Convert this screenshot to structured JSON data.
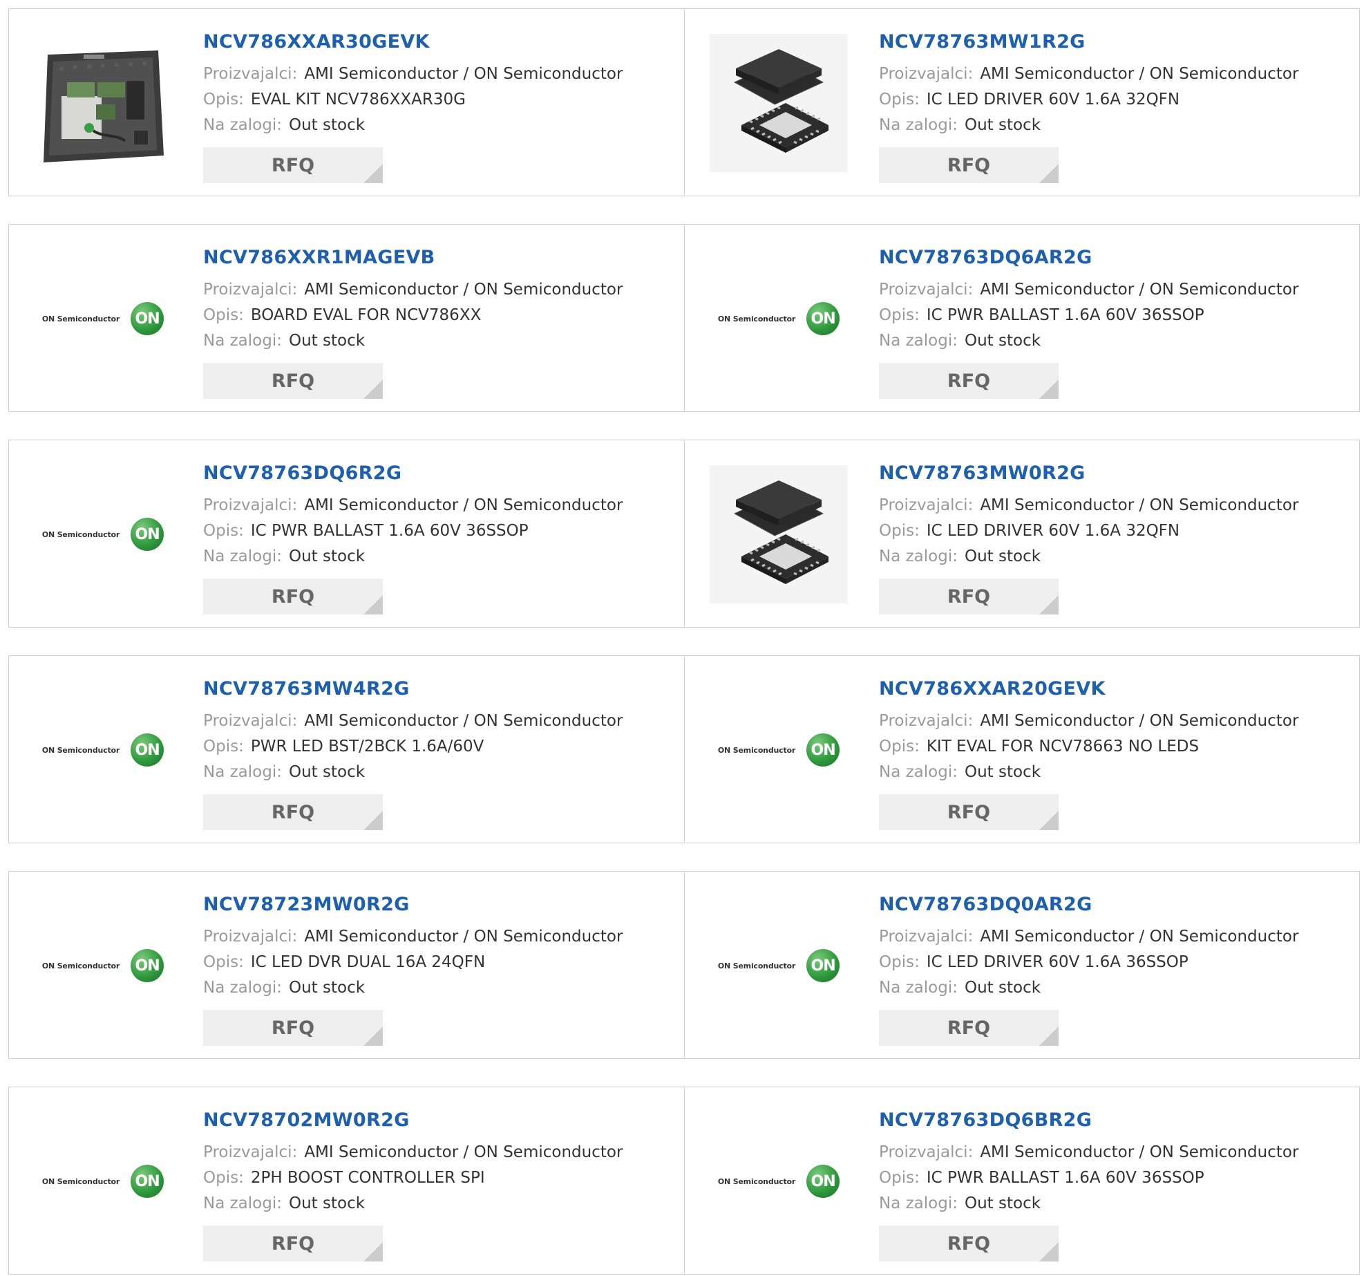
{
  "labels": {
    "manufacturer": "Proizvajalci:",
    "description": "Opis:",
    "stock": "Na zalogi:",
    "rfq": "RFQ"
  },
  "logo": {
    "text": "ON Semiconductor",
    "mark": "ON"
  },
  "rows": [
    [
      {
        "part": "NCV786XXAR30GEVK",
        "manufacturer": "AMI Semiconductor / ON Semiconductor",
        "description": "EVAL KIT NCV786XXAR30G",
        "stock": "Out stock",
        "image": "eval-kit-case-photo"
      },
      {
        "part": "NCV78763MW1R2G",
        "manufacturer": "AMI Semiconductor / ON Semiconductor",
        "description": "IC LED DRIVER 60V 1.6A 32QFN",
        "stock": "Out stock",
        "image": "qfn-chip-photo"
      }
    ],
    [
      {
        "part": "NCV786XXR1MAGEVB",
        "manufacturer": "AMI Semiconductor / ON Semiconductor",
        "description": "BOARD EVAL FOR NCV786XX",
        "stock": "Out stock",
        "image": "on-semiconductor-logo"
      },
      {
        "part": "NCV78763DQ6AR2G",
        "manufacturer": "AMI Semiconductor / ON Semiconductor",
        "description": "IC PWR BALLAST 1.6A 60V 36SSOP",
        "stock": "Out stock",
        "image": "on-semiconductor-logo"
      }
    ],
    [
      {
        "part": "NCV78763DQ6R2G",
        "manufacturer": "AMI Semiconductor / ON Semiconductor",
        "description": "IC PWR BALLAST 1.6A 60V 36SSOP",
        "stock": "Out stock",
        "image": "on-semiconductor-logo"
      },
      {
        "part": "NCV78763MW0R2G",
        "manufacturer": "AMI Semiconductor / ON Semiconductor",
        "description": "IC LED DRIVER 60V 1.6A 32QFN",
        "stock": "Out stock",
        "image": "qfn-chip-photo"
      }
    ],
    [
      {
        "part": "NCV78763MW4R2G",
        "manufacturer": "AMI Semiconductor / ON Semiconductor",
        "description": "PWR LED BST/2BCK 1.6A/60V",
        "stock": "Out stock",
        "image": "on-semiconductor-logo"
      },
      {
        "part": "NCV786XXAR20GEVK",
        "manufacturer": "AMI Semiconductor / ON Semiconductor",
        "description": "KIT EVAL FOR NCV78663 NO LEDS",
        "stock": "Out stock",
        "image": "on-semiconductor-logo"
      }
    ],
    [
      {
        "part": "NCV78723MW0R2G",
        "manufacturer": "AMI Semiconductor / ON Semiconductor",
        "description": "IC LED DVR DUAL 16A 24QFN",
        "stock": "Out stock",
        "image": "on-semiconductor-logo"
      },
      {
        "part": "NCV78763DQ0AR2G",
        "manufacturer": "AMI Semiconductor / ON Semiconductor",
        "description": "IC LED DRIVER 60V 1.6A 36SSOP",
        "stock": "Out stock",
        "image": "on-semiconductor-logo"
      }
    ],
    [
      {
        "part": "NCV78702MW0R2G",
        "manufacturer": "AMI Semiconductor / ON Semiconductor",
        "description": "2PH BOOST CONTROLLER SPI",
        "stock": "Out stock",
        "image": "on-semiconductor-logo"
      },
      {
        "part": "NCV78763DQ6BR2G",
        "manufacturer": "AMI Semiconductor / ON Semiconductor",
        "description": "IC PWR BALLAST 1.6A 60V 36SSOP",
        "stock": "Out stock",
        "image": "on-semiconductor-logo"
      }
    ]
  ]
}
